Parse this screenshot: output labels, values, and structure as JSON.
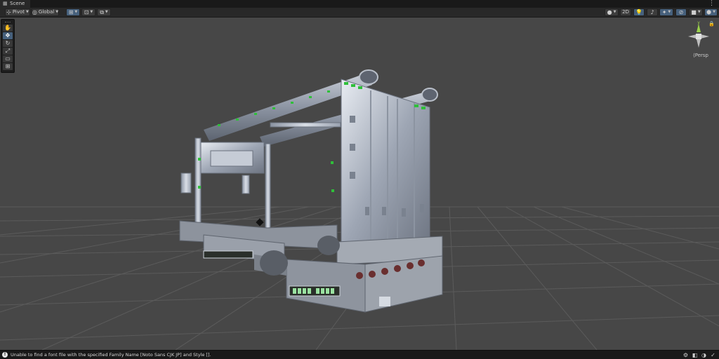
{
  "window": {
    "tab_label": "Scene",
    "tab_icon": "scene-icon",
    "menu_icon": "kebab-menu-icon"
  },
  "toolbar": {
    "pivot_label": "Pivot",
    "global_label": "Global",
    "mode_2d_label": "2D"
  },
  "tools": [
    {
      "name": "hand-tool",
      "glyph": "✋",
      "active": false
    },
    {
      "name": "move-tool",
      "glyph": "✥",
      "active": true
    },
    {
      "name": "rotate-tool",
      "glyph": "↻",
      "active": false
    },
    {
      "name": "scale-tool",
      "glyph": "⤢",
      "active": false
    },
    {
      "name": "rect-tool",
      "glyph": "▭",
      "active": false
    },
    {
      "name": "transform-tool",
      "glyph": "⊞",
      "active": false
    }
  ],
  "gizmo": {
    "projection_label": "Persp",
    "y_axis_label": "y"
  },
  "status": {
    "message": "Unable to find a font file with the specified Family Name [Noto Sans CJK JP] and Style [].",
    "icon": "info-icon"
  },
  "colors": {
    "viewport": "#474747",
    "grid": "#5a5a5a",
    "accent": "#46607c",
    "gizmo_y": "#9ad14b",
    "model_green": "#2fbf3a"
  }
}
